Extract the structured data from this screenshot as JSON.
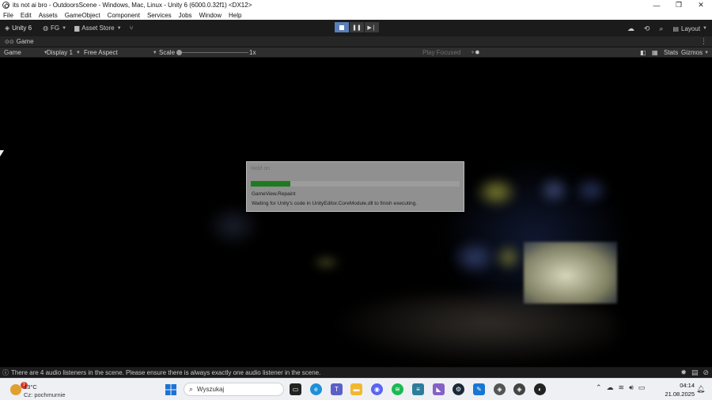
{
  "window": {
    "title": "its not ai bro - OutdoorsScene - Windows, Mac, Linux - Unity 6 (6000.0.32f1) <DX12>",
    "controls": [
      "—",
      "❐",
      "✕"
    ]
  },
  "menu": [
    "File",
    "Edit",
    "Assets",
    "GameObject",
    "Component",
    "Services",
    "Jobs",
    "Window",
    "Help"
  ],
  "toolbar": {
    "unity_label": "Unity 6",
    "account_label": "FG",
    "asset_store_label": "Asset Store",
    "layout_label": "Layout"
  },
  "tabs": {
    "game_tab": "Game"
  },
  "gamebar": {
    "view_select": "Game",
    "display_select": "Display 1",
    "aspect_select": "Free Aspect",
    "scale_label": "Scale",
    "scale_value": "1x",
    "play_mode": "Play Focused",
    "stats_label": "Stats",
    "gizmos_label": "Gizmos"
  },
  "dialog": {
    "title": "Hold on",
    "progress": 0.19,
    "step": "GameView.Repaint",
    "message": "Waiting for Unity's code in UnityEditor.CoreModule.dll to finish executing."
  },
  "status": {
    "message": "There are 4 audio listeners in the scene. Please ensure there is always exactly one audio listener in the scene."
  },
  "taskbar": {
    "weather_badge": "1",
    "weather_temp": "13°C",
    "weather_desc": "Cz: pochmurnie",
    "search_placeholder": "Wyszukaj",
    "discord_badge": "",
    "time": "04:14",
    "date": "21.08.2025"
  },
  "colors": {
    "play_active": "#5a7fb8",
    "progress_fill": "#1f7a1f",
    "editor_bg": "#1b1b1b"
  }
}
